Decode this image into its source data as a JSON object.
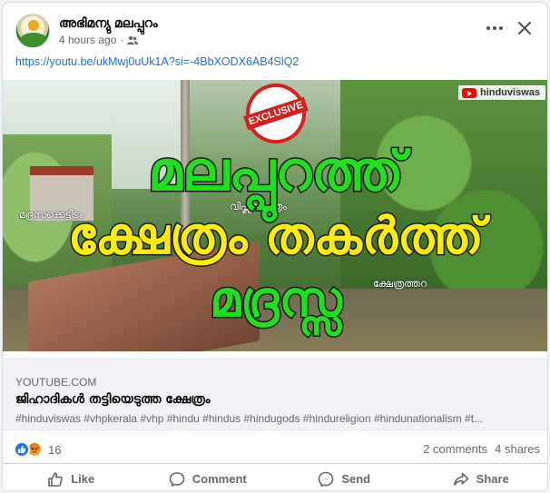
{
  "post": {
    "author": "അഭിമന്യു മലപ്പുറം",
    "time": "4 hours ago",
    "privacy_icon": "friends-icon",
    "link_text": "https://youtu.be/ukMwj0uUk1A?si=-4BbXODX6AB4SlQ2"
  },
  "thumbnail": {
    "line1": "മലപ്പുറത്ത്",
    "line2": "ക്ഷേത്രം തകർത്ത്",
    "line3": "മദ്രസ്സ",
    "badge": "EXCLUSIVE",
    "channel": "hinduviswas",
    "caption_left": "മദ്രസക്കെട്ടിടം",
    "caption_mid": "വിഷ്ണുക്ഷേത്രം",
    "caption_right": "ക്ഷേത്രത്തറ"
  },
  "link_preview": {
    "domain": "YOUTUBE.COM",
    "title": "ജിഹാദികൾ തട്ടിയെടുത്ത ക്ഷേത്രം",
    "description": "#hinduviswas #vhpkerala #vhp #hindu #hindus #hindugods #hindureligion #hindunationalism #t..."
  },
  "stats": {
    "reaction_count": "16",
    "comments": "2 comments",
    "shares": "4 shares"
  },
  "actions": {
    "like": "Like",
    "comment": "Comment",
    "send": "Send",
    "share": "Share"
  },
  "colors": {
    "link": "#216fdb",
    "like_blue": "#1877f2",
    "muted": "#65676b"
  }
}
